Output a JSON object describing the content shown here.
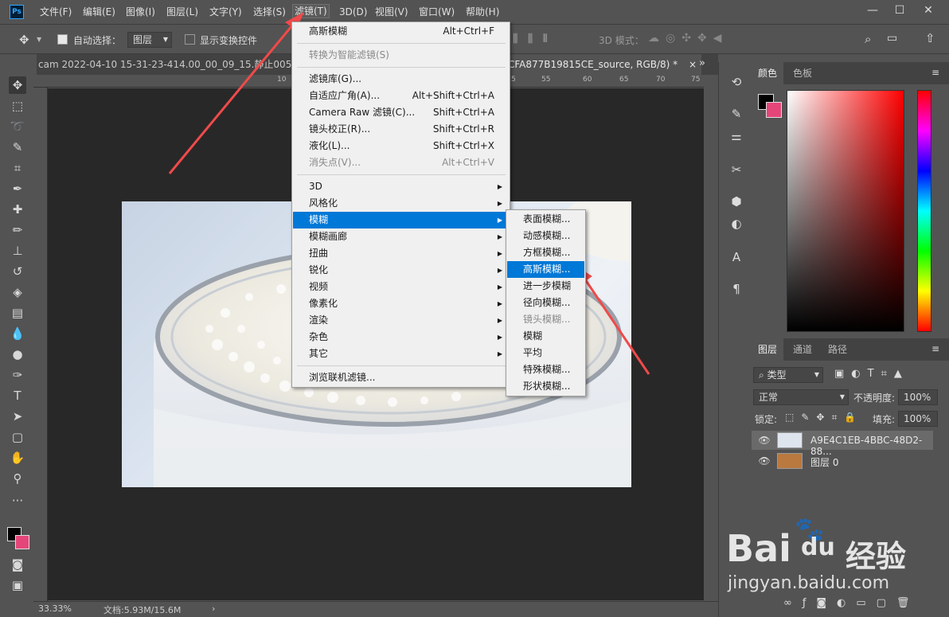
{
  "app": {
    "logo": "Ps"
  },
  "menubar": {
    "items": [
      "文件(F)",
      "编辑(E)",
      "图像(I)",
      "图层(L)",
      "文字(Y)",
      "选择(S)",
      "滤镜(T)",
      "3D(D)",
      "视图(V)",
      "窗口(W)",
      "帮助(H)"
    ],
    "active_index": 6
  },
  "options": {
    "auto_select_label": "自动选择：",
    "auto_select_value": "图层",
    "show_transform_label": "显示变换控件",
    "mode_3d_label": "3D 模式："
  },
  "tabs": {
    "doc1": "cam 2022-04-10 15-31-23-414.00_00_09_15.静止00",
    "doc1_suffix": "5.png",
    "doc2": "CFA877B19815CE_source, RGB/8) *",
    "close": "×",
    "overflow": "»"
  },
  "ruler": {
    "top_numbers": [
      "10",
      "5",
      "55",
      "60",
      "65",
      "70",
      "75"
    ]
  },
  "status": {
    "zoom": "33.33%",
    "doc": "文档:5.93M/15.6M",
    "arrow": "›"
  },
  "color_panel": {
    "tabs": [
      "颜色",
      "色板"
    ],
    "fg": "#000000",
    "bg": "#e5467a"
  },
  "layers_panel": {
    "tabs": [
      "图层",
      "通道",
      "路径"
    ],
    "filter_kind": "类型",
    "blend_mode": "正常",
    "opacity_label": "不透明度:",
    "opacity_value": "100%",
    "lock_label": "锁定:",
    "fill_label": "填充:",
    "fill_value": "100%",
    "layers": [
      {
        "name": "A9E4C1EB-4BBC-48D2-88...",
        "selected": true
      },
      {
        "name": "图层 0",
        "selected": false
      }
    ]
  },
  "filter_menu": {
    "items": [
      {
        "label": "高斯模糊",
        "shortcut": "Alt+Ctrl+F",
        "disabled": false
      },
      {
        "sep": true
      },
      {
        "label": "转换为智能滤镜(S)",
        "shortcut": "",
        "disabled": true
      },
      {
        "sep": true
      },
      {
        "label": "滤镜库(G)...",
        "shortcut": "",
        "disabled": false
      },
      {
        "label": "自适应广角(A)...",
        "shortcut": "Alt+Shift+Ctrl+A",
        "disabled": false
      },
      {
        "label": "Camera Raw 滤镜(C)...",
        "shortcut": "Shift+Ctrl+A",
        "disabled": false
      },
      {
        "label": "镜头校正(R)...",
        "shortcut": "Shift+Ctrl+R",
        "disabled": false
      },
      {
        "label": "液化(L)...",
        "shortcut": "Shift+Ctrl+X",
        "disabled": false
      },
      {
        "label": "消失点(V)...",
        "shortcut": "Alt+Ctrl+V",
        "disabled": true
      },
      {
        "sep": true
      },
      {
        "label": "3D",
        "submenu": true
      },
      {
        "label": "风格化",
        "submenu": true
      },
      {
        "label": "模糊",
        "submenu": true,
        "highlighted": true
      },
      {
        "label": "模糊画廊",
        "submenu": true
      },
      {
        "label": "扭曲",
        "submenu": true
      },
      {
        "label": "锐化",
        "submenu": true
      },
      {
        "label": "视频",
        "submenu": true
      },
      {
        "label": "像素化",
        "submenu": true
      },
      {
        "label": "渲染",
        "submenu": true
      },
      {
        "label": "杂色",
        "submenu": true
      },
      {
        "label": "其它",
        "submenu": true
      },
      {
        "sep": true
      },
      {
        "label": "浏览联机滤镜...",
        "shortcut": ""
      }
    ]
  },
  "blur_menu": {
    "items": [
      {
        "label": "表面模糊...",
        "disabled": false
      },
      {
        "label": "动感模糊...",
        "disabled": false
      },
      {
        "label": "方框模糊...",
        "disabled": false
      },
      {
        "label": "高斯模糊...",
        "disabled": false,
        "highlighted": true
      },
      {
        "label": "进一步模糊",
        "disabled": false
      },
      {
        "label": "径向模糊...",
        "disabled": false
      },
      {
        "label": "镜头模糊...",
        "disabled": true
      },
      {
        "label": "模糊",
        "disabled": false
      },
      {
        "label": "平均",
        "disabled": false
      },
      {
        "label": "特殊模糊...",
        "disabled": false
      },
      {
        "label": "形状模糊...",
        "disabled": false
      }
    ]
  },
  "watermark": {
    "brand": "Bai",
    "brand2": "du",
    "cn": "经验",
    "url": "jingyan.baidu.com"
  },
  "colors": {
    "accent": "#0078d7",
    "arrow": "#f04a4a"
  }
}
